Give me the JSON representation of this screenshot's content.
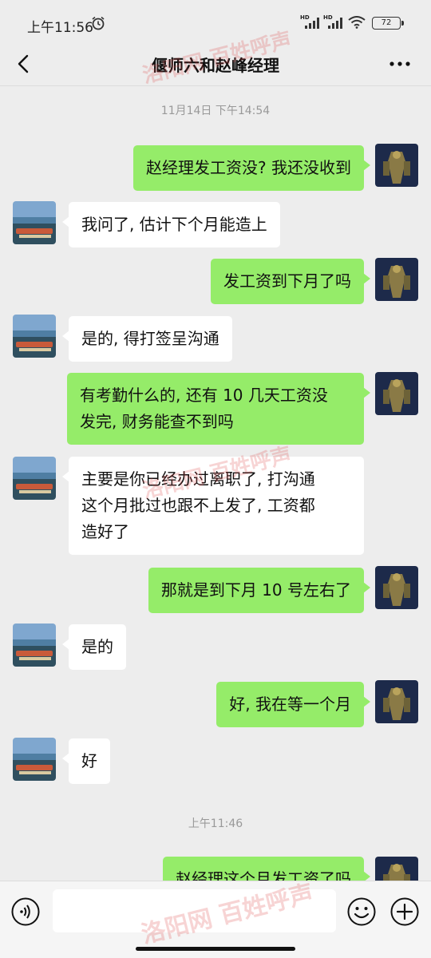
{
  "status": {
    "time": "上午11:56",
    "hd1": "HD",
    "hd2": "HD",
    "battery": "72"
  },
  "header": {
    "title": "偃师六和赵峰经理"
  },
  "messages": [
    {
      "kind": "time",
      "text": "11月14日 下午14:54"
    },
    {
      "kind": "self",
      "text": "赵经理发工资没? 我还没收到"
    },
    {
      "kind": "other",
      "text": "我问了, 估计下个月能造上"
    },
    {
      "kind": "self",
      "text": "发工资到下月了吗"
    },
    {
      "kind": "other",
      "text": "是的, 得打签呈沟通"
    },
    {
      "kind": "self",
      "lines": [
        "有考勤什么的, 还有 10 几天工资没",
        "发完, 财务能查不到吗"
      ]
    },
    {
      "kind": "other",
      "lines": [
        "主要是你已经办过离职了, 打沟通",
        "这个月批过也跟不上发了, 工资都",
        "造好了"
      ]
    },
    {
      "kind": "self",
      "text": "那就是到下月 10 号左右了"
    },
    {
      "kind": "other",
      "text": "是的"
    },
    {
      "kind": "self",
      "text": "好, 我在等一个月"
    },
    {
      "kind": "other",
      "text": "好"
    },
    {
      "kind": "time",
      "text": "上午11:46"
    },
    {
      "kind": "self",
      "text": "赵经理这个月发工资了吗"
    }
  ],
  "watermark": {
    "text": "洛阳网 百姓呼声"
  },
  "input": {
    "value": ""
  },
  "colors": {
    "self_bubble": "#95ec69",
    "other_bubble": "#ffffff",
    "background": "#ededed"
  },
  "icons": {
    "back": "chevron-left-icon",
    "more": "more-dots-icon",
    "voice": "voice-icon",
    "emoji": "emoji-icon",
    "plus": "plus-icon",
    "alarm": "alarm-clock-icon",
    "wifi": "wifi-icon"
  }
}
